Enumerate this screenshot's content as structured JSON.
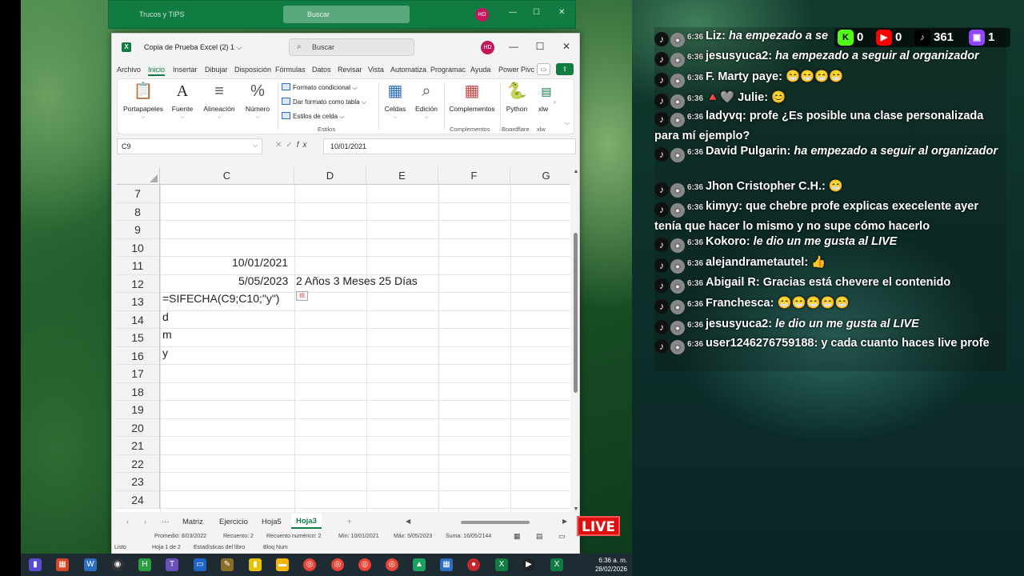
{
  "back_window": {
    "title": "Trucos y TIPS",
    "search": "Buscar",
    "avatar": "HD"
  },
  "window": {
    "title": "Copia de Prueba Excel (2) 1",
    "search": "Buscar",
    "avatar": "HD",
    "controls": {
      "minimize": "—",
      "maximize": "☐",
      "close": "✕"
    }
  },
  "ribbon_tabs": [
    "Archivo",
    "Inicio",
    "Insertar",
    "Dibujar",
    "Disposición",
    "Fórmulas",
    "Datos",
    "Revisar",
    "Vista",
    "Automatiza",
    "Programac",
    "Ayuda",
    "Power Pivc"
  ],
  "ribbon": {
    "portapapeles": "Portapapeles",
    "fuente": "Fuente",
    "alineacion": "Alineación",
    "numero": "Número",
    "formato_condicional": "Formato condicional",
    "dar_formato_tabla": "Dar formato como tabla",
    "estilos_celda": "Estilos de celda",
    "estilos_group": "Estilos",
    "celdas": "Celdas",
    "edicion": "Edición",
    "complementos": "Complementos",
    "complementos_group": "Complementos",
    "python": "Python",
    "boardflare": "Boardflare",
    "xlw": "xlw",
    "xlw_group": "xlw"
  },
  "formula_bar": {
    "name_box": "C9",
    "formula": "10/01/2021",
    "fx": "fx"
  },
  "grid": {
    "columns": [
      "C",
      "D",
      "E",
      "F",
      "G"
    ],
    "rows": [
      "7",
      "8",
      "9",
      "10",
      "11",
      "12",
      "13",
      "14",
      "15",
      "16",
      "17",
      "18",
      "19",
      "20",
      "21",
      "22",
      "23",
      "24"
    ],
    "cells": {
      "c9": "10/01/2021",
      "c10": "5/05/2023",
      "d10": "2 Años 3 Meses 25 Días",
      "c11": "=SIFECHA(C9;C10;\"y\")",
      "c12": "d",
      "c13": "m",
      "c14": "y"
    }
  },
  "sheet_tabs": [
    "Matriz",
    "Ejercicio",
    "Hoja5",
    "Hoja3"
  ],
  "active_sheet": "Hoja3",
  "status_bar": {
    "promedio": "Promedio: 8/03/2022",
    "recuento": "Recuento: 2",
    "recuento_num": "Recuento numérico: 2",
    "min": "Mín: 10/01/2021",
    "max": "Máx: 5/05/2023",
    "suma": "Suma: 16/05/2144"
  },
  "ready_bar": {
    "ready": "Listo",
    "hoja": "Hoja 1 de 2",
    "estadisticas": "Estadísticas del libro",
    "bloq": "Bloq Num"
  },
  "live_badge": "LIVE",
  "taskbar": {
    "time": "6:36 a. m.",
    "date": "28/02/2026"
  },
  "counters": {
    "kick": "0",
    "youtube": "0",
    "tiktok": "361",
    "twitch": "1"
  },
  "chat": [
    {
      "time": "6:36",
      "name": "Liz:",
      "text": "ha empezado a se",
      "italic": true
    },
    {
      "time": "6:36",
      "name": "jesusyuca2:",
      "text": "ha empezado a seguir al organizador",
      "italic": true
    },
    {
      "time": "6:36",
      "name": "F. Marty paye:",
      "text": "😁😁😁😁",
      "italic": false
    },
    {
      "time": "6:36",
      "name": "🔺🩶 Julie:",
      "text": "😊",
      "italic": false
    },
    {
      "time": "6:36",
      "name": "ladyvq:",
      "text": "profe ¿Es posible una clase personalizada para mí ejemplo?",
      "italic": false
    },
    {
      "time": "6:36",
      "name": "David Pulgarin:",
      "text": "ha empezado a seguir al organizador",
      "italic": true
    },
    {
      "time": "6:36",
      "name": "Jhon Cristopher C.H.:",
      "text": "😁",
      "italic": false
    },
    {
      "time": "6:36",
      "name": "kimyy:",
      "text": "que chebre profe explicas execelente ayer tenía que hacer lo mismo y no supe cómo hacerlo",
      "italic": false
    },
    {
      "time": "6:36",
      "name": "Kokoro:",
      "text": "le dio un me gusta al LIVE",
      "italic": true
    },
    {
      "time": "6:36",
      "name": "alejandrametautel:",
      "text": "👍",
      "italic": false
    },
    {
      "time": "6:36",
      "name": "Abigail R:",
      "text": "Gracias está chevere el contenido",
      "italic": false
    },
    {
      "time": "6:36",
      "name": "Franchesca:",
      "text": "😁😁😁😁😁",
      "italic": false
    },
    {
      "time": "6:36",
      "name": "jesusyuca2:",
      "text": "le dio un me gusta al LIVE",
      "italic": true
    },
    {
      "time": "6:36",
      "name": "user1246276759188:",
      "text": "y cada cuanto haces live profe",
      "italic": false
    }
  ]
}
